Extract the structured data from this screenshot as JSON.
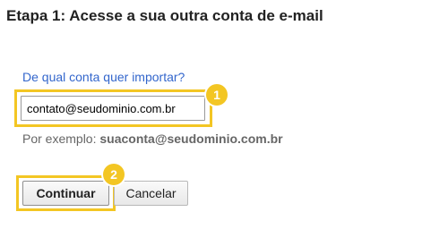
{
  "step": {
    "title": "Etapa 1: Acesse a sua outra conta de e-mail"
  },
  "form": {
    "question_label": "De qual conta quer importar?",
    "email_value": "contato@seudominio.com.br",
    "example_prefix": "Por exemplo: ",
    "example_value": "suaconta@seudominio.com.br"
  },
  "buttons": {
    "continue_label": "Continuar",
    "cancel_label": "Cancelar"
  },
  "badges": {
    "first": "1",
    "second": "2"
  },
  "colors": {
    "highlight": "#f3c623",
    "link": "#3366cc",
    "hint_text": "#666666"
  }
}
